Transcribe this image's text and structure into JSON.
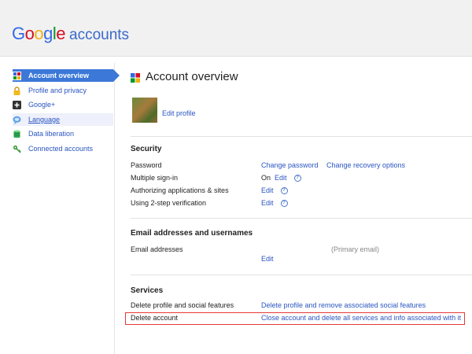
{
  "header": {
    "logo_letters": [
      "G",
      "o",
      "o",
      "g",
      "l",
      "e"
    ],
    "logo_suffix": "accounts"
  },
  "sidebar": {
    "items": [
      {
        "label": "Account overview",
        "icon": "google-g-icon",
        "state": "active"
      },
      {
        "label": "Profile and privacy",
        "icon": "lock-icon",
        "state": "normal"
      },
      {
        "label": "Google+",
        "icon": "google-plus-icon",
        "state": "normal"
      },
      {
        "label": "Language",
        "icon": "speech-bubble-icon",
        "state": "hover"
      },
      {
        "label": "Data liberation",
        "icon": "database-icon",
        "state": "normal"
      },
      {
        "label": "Connected accounts",
        "icon": "key-icon",
        "state": "normal"
      }
    ]
  },
  "main": {
    "title": "Account overview",
    "edit_profile": "Edit profile",
    "security": {
      "title": "Security",
      "rows": [
        {
          "label": "Password",
          "action1": "Change password",
          "action2": "Change recovery options"
        },
        {
          "label": "Multiple sign-in",
          "status": "On",
          "action1": "Edit",
          "help": "?"
        },
        {
          "label": "Authorizing applications & sites",
          "action1": "Edit",
          "help": "?"
        },
        {
          "label": "Using 2-step verification",
          "action1": "Edit",
          "help": "?"
        }
      ]
    },
    "email": {
      "title": "Email addresses and usernames",
      "label": "Email addresses",
      "primary_note": "(Primary email)",
      "edit": "Edit"
    },
    "services": {
      "title": "Services",
      "rows": [
        {
          "label": "Delete profile and social features",
          "action": "Delete profile and remove associated social features"
        },
        {
          "label": "Delete account",
          "action": "Close account and delete all services and info associated with it"
        }
      ]
    }
  },
  "colors": {
    "link": "#2a55c0",
    "active_nav": "#3c78d8",
    "highlight_border": "#e53935"
  }
}
